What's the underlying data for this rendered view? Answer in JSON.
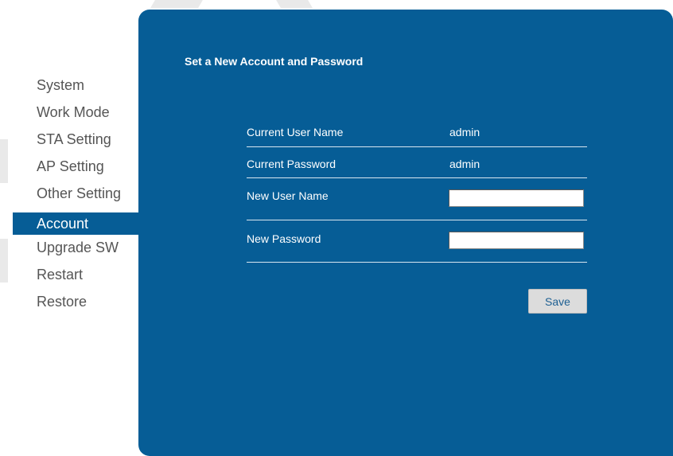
{
  "sidebar": {
    "items": [
      {
        "label": "System"
      },
      {
        "label": "Work Mode"
      },
      {
        "label": "STA Setting"
      },
      {
        "label": "AP Setting"
      },
      {
        "label": "Other Setting"
      },
      {
        "label": "Account",
        "active": true
      },
      {
        "label": "Upgrade SW"
      },
      {
        "label": "Restart"
      },
      {
        "label": "Restore"
      }
    ]
  },
  "panel": {
    "title": "Set a New Account and Password",
    "current_user_name_label": "Current User Name",
    "current_user_name_value": "admin",
    "current_password_label": "Current Password",
    "current_password_value": "admin",
    "new_user_name_label": "New User Name",
    "new_user_name_value": "",
    "new_password_label": "New Password",
    "new_password_value": "",
    "save_label": "Save"
  },
  "colors": {
    "panel_bg": "#065d96",
    "active_item_bg": "#065d96",
    "sidebar_text": "#555555",
    "button_bg": "#dcdcdc"
  }
}
